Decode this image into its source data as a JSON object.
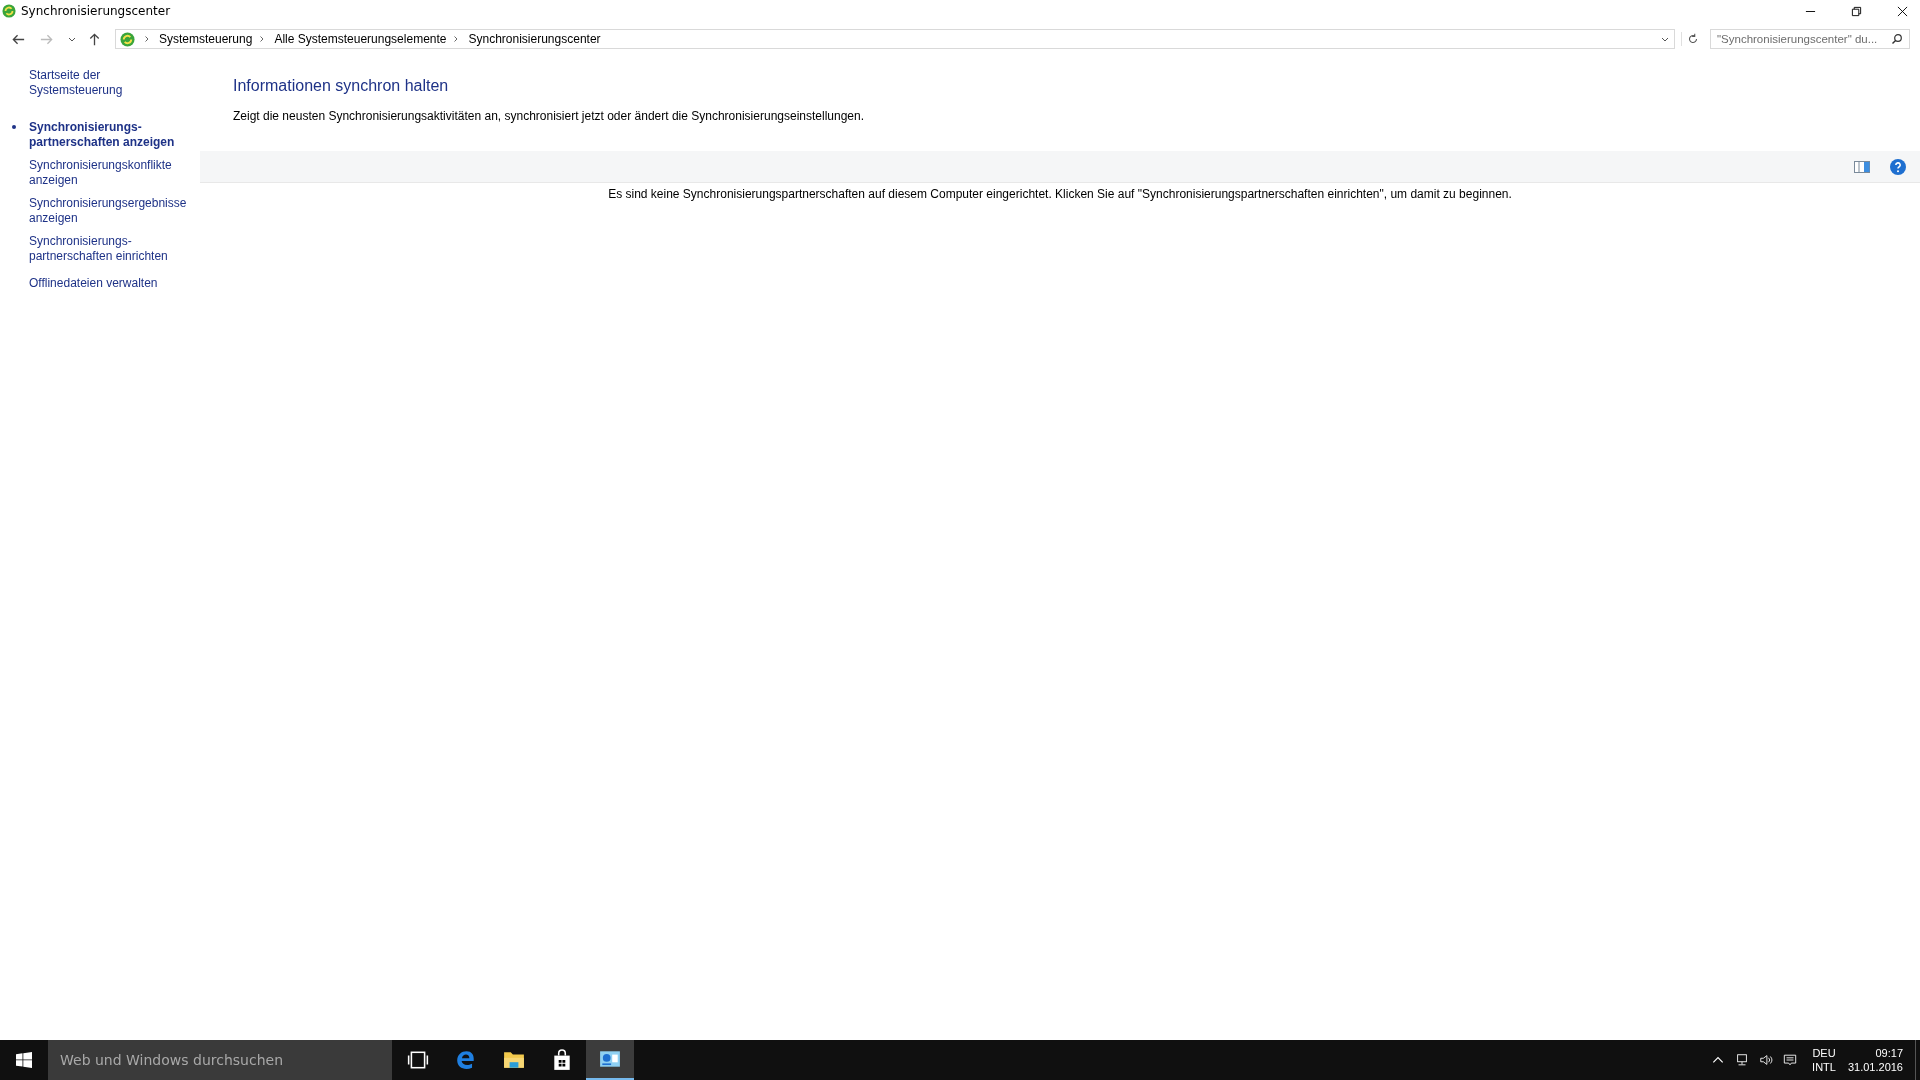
{
  "window": {
    "title": "Synchronisierungscenter"
  },
  "address_bar": {
    "breadcrumbs": [
      "Systemsteuerung",
      "Alle Systemsteuerungselemente",
      "Synchronisierungscenter"
    ],
    "search_placeholder": "\"Synchronisierungscenter\" du..."
  },
  "sidebar": {
    "items": [
      {
        "label": "Startseite der Systemsteuerung",
        "selected": false
      },
      {
        "label": "Synchronisierungs-partnerschaften anzeigen",
        "selected": true
      },
      {
        "label": "Synchronisierungskonflikte anzeigen",
        "selected": false
      },
      {
        "label": "Synchronisierungsergebnisse anzeigen",
        "selected": false
      },
      {
        "label": "Synchronisierungs-partnerschaften einrichten",
        "selected": false
      },
      {
        "label": "Offlinedateien verwalten",
        "selected": false
      }
    ]
  },
  "content": {
    "heading": "Informationen synchron halten",
    "description": "Zeigt die neusten Synchronisierungsaktivitäten an, synchronisiert jetzt oder ändert die Synchronisierungseinstellungen.",
    "message": "Es sind keine Synchronisierungspartnerschaften auf diesem Computer eingerichtet. Klicken Sie auf \"Synchronisierungspartnerschaften einrichten\", um damit zu beginnen."
  },
  "taskbar": {
    "search_placeholder": "Web und Windows durchsuchen",
    "apps": [
      {
        "kind": "taskview",
        "selected": false
      },
      {
        "kind": "edge",
        "selected": false
      },
      {
        "kind": "explorer",
        "selected": false
      },
      {
        "kind": "store",
        "selected": false
      },
      {
        "kind": "controlpanel",
        "selected": true
      }
    ],
    "language": [
      "DEU",
      "INTL"
    ],
    "time": "09:17",
    "date": "31.01.2016"
  }
}
